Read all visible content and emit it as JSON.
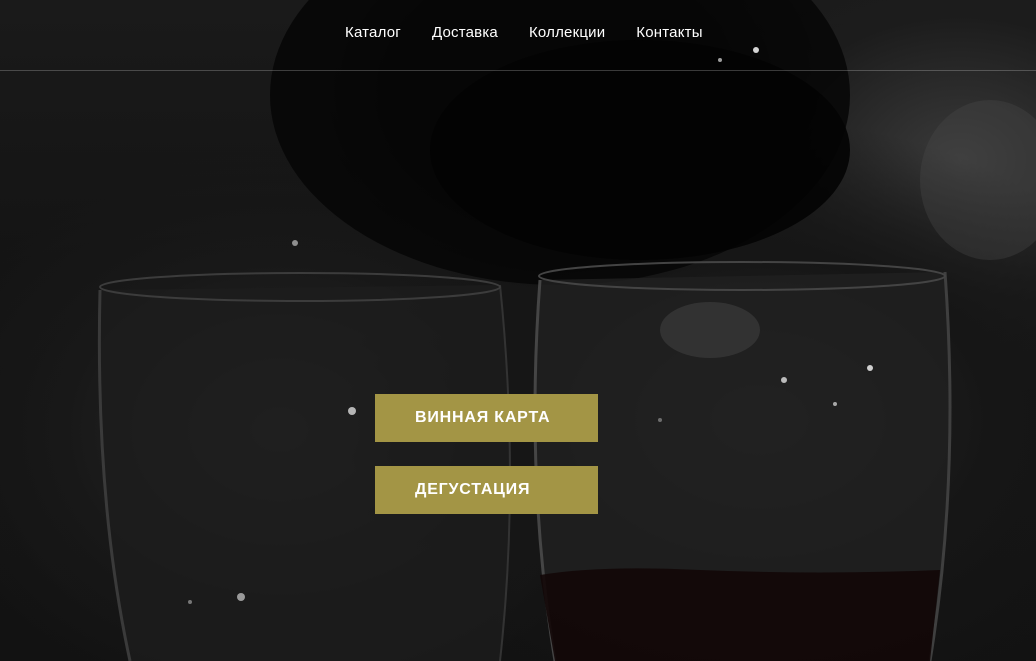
{
  "nav": {
    "items": [
      {
        "label": "Каталог"
      },
      {
        "label": "Доставка"
      },
      {
        "label": "Коллекции"
      },
      {
        "label": "Контакты"
      }
    ]
  },
  "actions": {
    "wine_list_label": "ВИННАЯ КАРТА",
    "tasting_label": "ДЕГУСТАЦИЯ"
  },
  "colors": {
    "button_bg": "#a39545",
    "button_text": "#ffffff",
    "nav_text": "#ffffff",
    "background": "#141414"
  }
}
